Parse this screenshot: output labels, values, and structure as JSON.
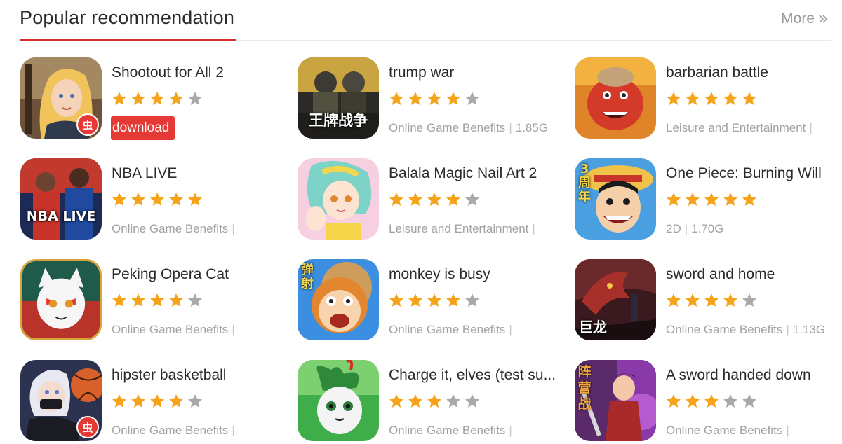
{
  "header": {
    "title": "Popular recommendation",
    "more_label": "More",
    "accent_color": "#d32f2f"
  },
  "colors": {
    "star_filled": "#f5a31a",
    "star_empty": "#a9a9a9",
    "download_bg": "#e53935"
  },
  "games": [
    {
      "title": "Shootout for All 2",
      "rating": 4,
      "action": "download",
      "icon": "blonde-soldier-girl-icon",
      "badge": "虫"
    },
    {
      "title": "trump war",
      "rating": 4,
      "meta": [
        "Online Game Benefits",
        "1.85G"
      ],
      "icon": "soldiers-icon",
      "tile_text": "王牌战争"
    },
    {
      "title": "barbarian battle",
      "rating": 5,
      "meta": [
        "Leisure and Entertainment",
        ""
      ],
      "icon": "red-barbarian-icon"
    },
    {
      "title": "NBA LIVE",
      "rating": 5,
      "meta": [
        "Online Game Benefits",
        ""
      ],
      "icon": "basketball-players-icon",
      "tile_text": "NBA LIVE"
    },
    {
      "title": "Balala Magic Nail Art 2",
      "rating": 4,
      "meta": [
        "Leisure and Entertainment",
        ""
      ],
      "icon": "anime-girl-nails-icon"
    },
    {
      "title": "One Piece: Burning Will",
      "rating": 5,
      "meta": [
        "2D",
        "1.70G"
      ],
      "icon": "straw-hat-pirate-icon",
      "side_text": "3周年"
    },
    {
      "title": "Peking Opera Cat",
      "rating": 4,
      "meta": [
        "Online Game Benefits",
        ""
      ],
      "icon": "opera-cat-icon"
    },
    {
      "title": "monkey is busy",
      "rating": 4,
      "meta": [
        "Online Game Benefits",
        ""
      ],
      "icon": "busy-monkey-icon",
      "side_text": "弹射"
    },
    {
      "title": "sword and home",
      "rating": 4,
      "meta": [
        "Online Game Benefits",
        "1.13G"
      ],
      "icon": "dragon-warrior-icon",
      "tile_text": "巨龙"
    },
    {
      "title": "hipster basketball",
      "rating": 4,
      "meta": [
        "Online Game Benefits",
        ""
      ],
      "icon": "masked-baller-icon",
      "badge": "虫"
    },
    {
      "title": "Charge it, elves (test su...",
      "rating": 3,
      "meta": [
        "Online Game Benefits",
        ""
      ],
      "icon": "green-elf-creature-icon"
    },
    {
      "title": "A sword handed down",
      "rating": 3,
      "meta": [
        "Online Game Benefits",
        ""
      ],
      "icon": "sword-hero-icon",
      "side_text": "阵营战"
    }
  ]
}
